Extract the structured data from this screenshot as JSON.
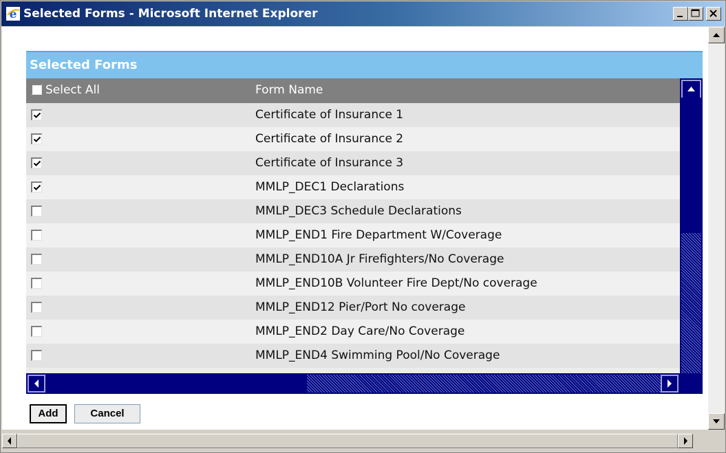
{
  "window": {
    "title": "Selected Forms - Microsoft Internet Explorer",
    "icon": "internet-explorer-icon",
    "controls": [
      "minimize",
      "maximize",
      "close"
    ]
  },
  "panel": {
    "title": "Selected Forms"
  },
  "grid": {
    "select_all_label": "Select All",
    "select_all_checked": false,
    "column_header": "Form Name",
    "rows": [
      {
        "name": "Certificate of Insurance 1",
        "checked": true
      },
      {
        "name": "Certificate of Insurance 2",
        "checked": true
      },
      {
        "name": "Certificate of Insurance 3",
        "checked": true
      },
      {
        "name": "MMLP_DEC1 Declarations",
        "checked": true
      },
      {
        "name": "MMLP_DEC3 Schedule Declarations",
        "checked": false
      },
      {
        "name": "MMLP_END1 Fire Department W/Coverage",
        "checked": false
      },
      {
        "name": "MMLP_END10A Jr Firefighters/No Coverage",
        "checked": false
      },
      {
        "name": "MMLP_END10B Volunteer Fire Dept/No coverage",
        "checked": false
      },
      {
        "name": "MMLP_END12 Pier/Port No coverage",
        "checked": false
      },
      {
        "name": "MMLP_END2 Day Care/No Coverage",
        "checked": false
      },
      {
        "name": "MMLP_END4 Swimming Pool/No Coverage",
        "checked": false
      }
    ]
  },
  "buttons": {
    "add": "Add",
    "cancel": "Cancel"
  },
  "colors": {
    "title_bar": "#0a246a",
    "panel_header": "#7fc2ee",
    "grid_header": "#808080",
    "grid_scrollbar": "#000080"
  }
}
